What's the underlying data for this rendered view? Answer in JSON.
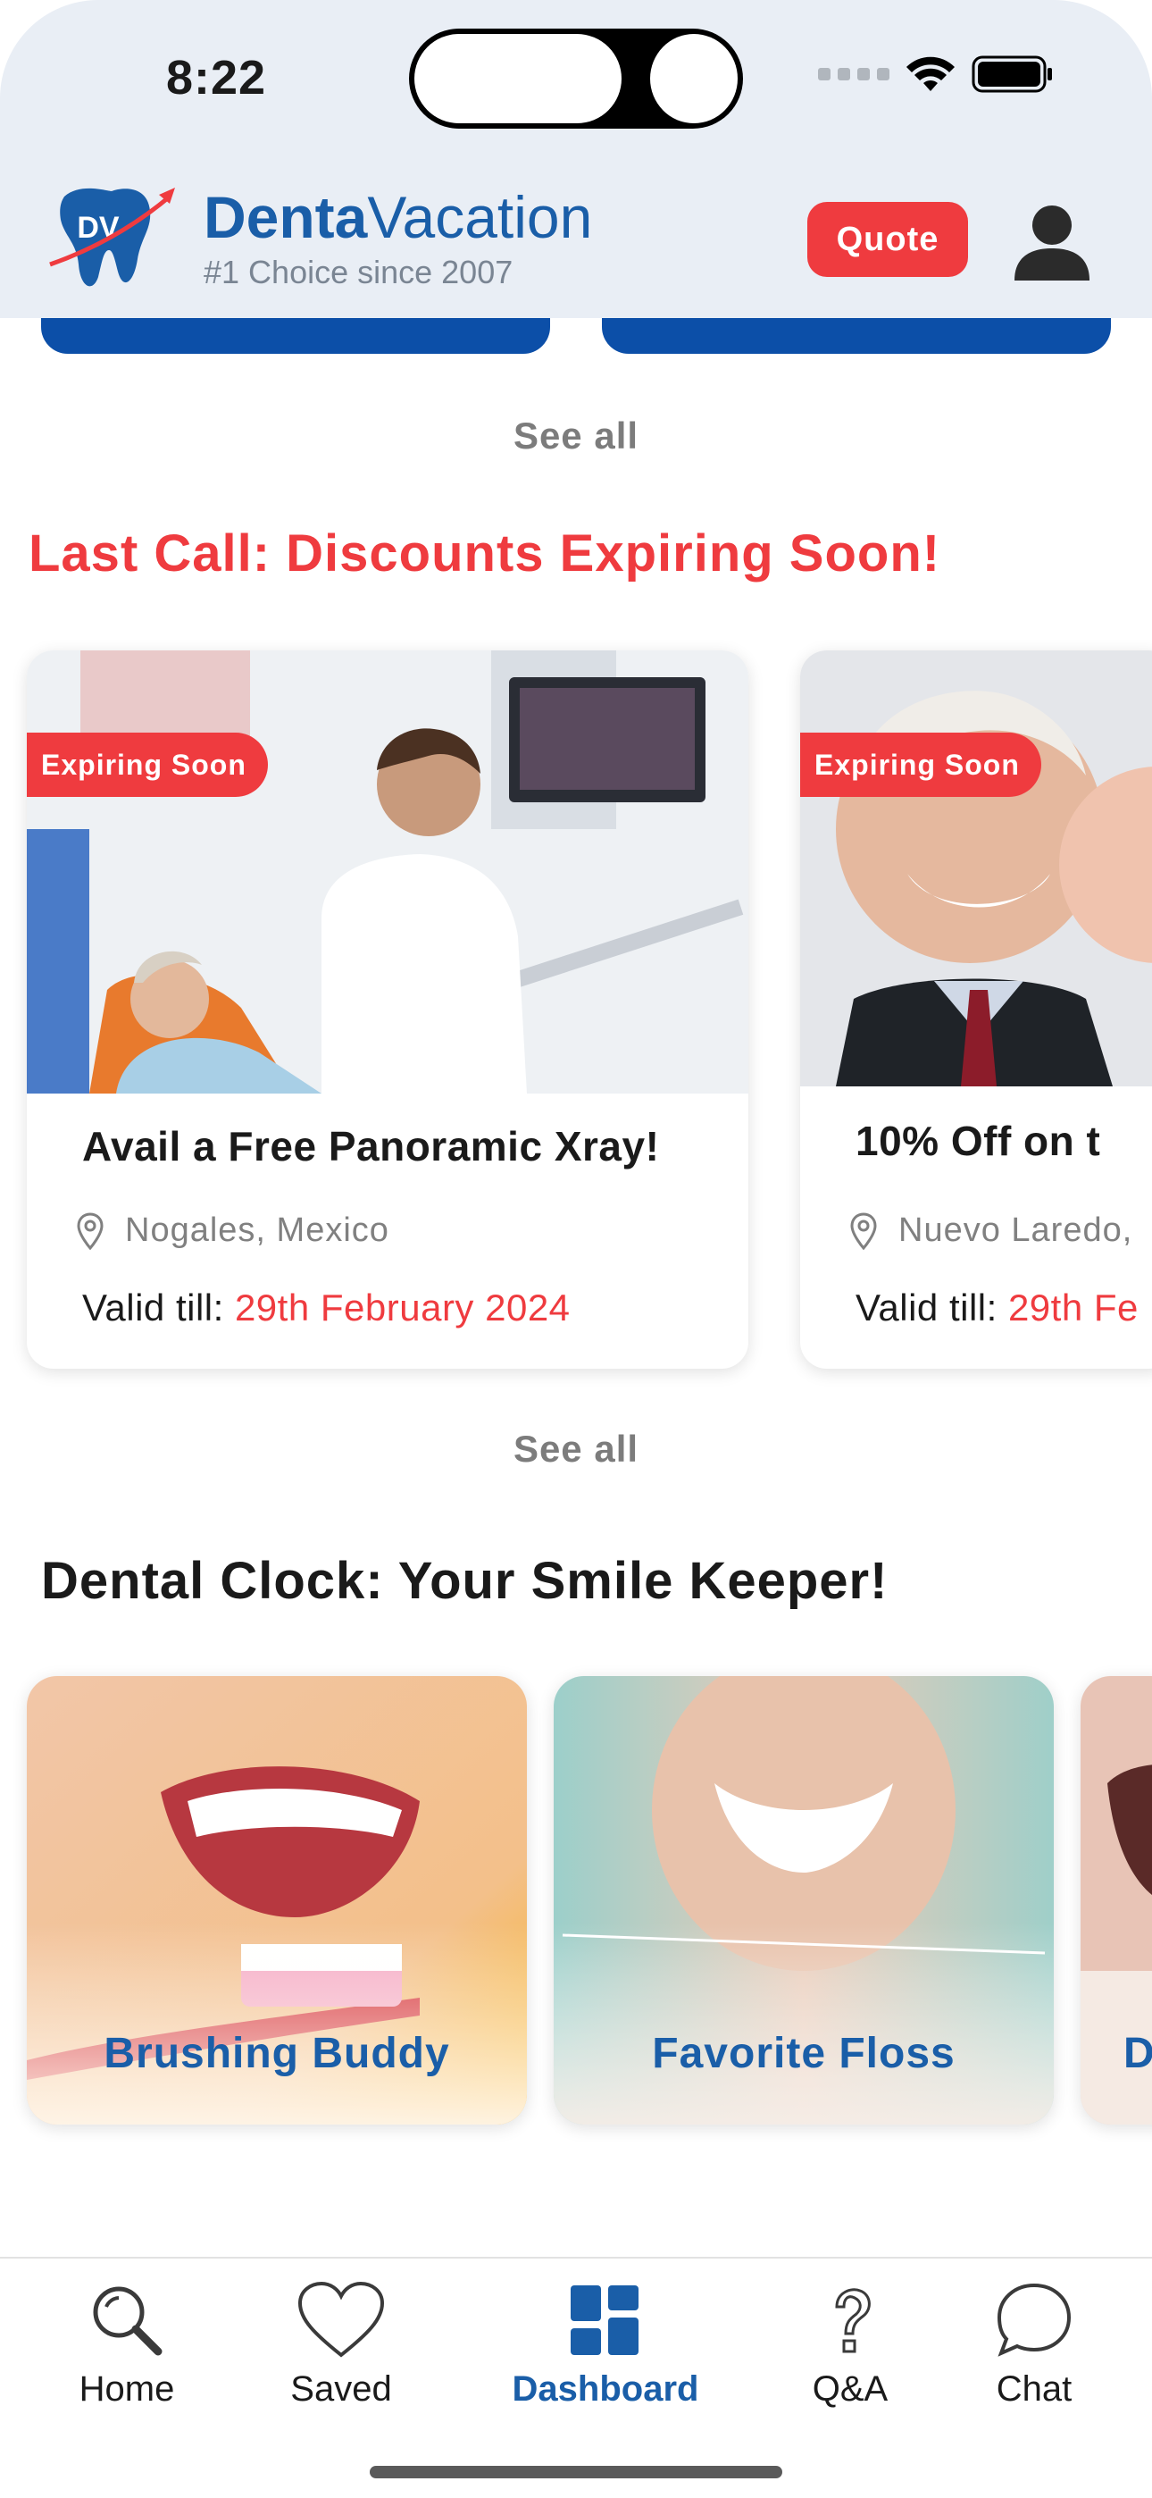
{
  "status_bar": {
    "time": "8:22"
  },
  "header": {
    "logo_text": "DV",
    "brand_bold": "Denta",
    "brand_light": "Vacation",
    "tagline": "#1 Choice since 2007",
    "quote_label": "Quote"
  },
  "see_all_label": "See all",
  "deals": {
    "title": "Last Call: Discounts Expiring Soon!",
    "valid_prefix": "Valid till: ",
    "items": [
      {
        "badge": "Expiring Soon",
        "title": "Avail a Free Panoramic Xray!",
        "location": "Nogales, Mexico",
        "valid_date": "29th February 2024"
      },
      {
        "badge": "Expiring Soon",
        "title": "10% Off on t",
        "location": "Nuevo Laredo,",
        "valid_date": "29th Fe"
      }
    ]
  },
  "dental_clock": {
    "title": "Dental Clock: Your Smile Keeper!",
    "items": [
      {
        "label": "Brushing Buddy"
      },
      {
        "label": "Favorite Floss"
      },
      {
        "label": "D"
      }
    ]
  },
  "tabbar": {
    "items": [
      {
        "label": "Home",
        "icon": "search-icon"
      },
      {
        "label": "Saved",
        "icon": "heart-icon"
      },
      {
        "label": "Dashboard",
        "icon": "dashboard-icon",
        "active": true
      },
      {
        "label": "Q&A",
        "icon": "question-icon"
      },
      {
        "label": "Chat",
        "icon": "chat-bubble-icon"
      }
    ]
  },
  "colors": {
    "brand_blue": "#1a5ea8",
    "accent_red": "#ef3b3f",
    "header_bg": "#e9eef5"
  }
}
